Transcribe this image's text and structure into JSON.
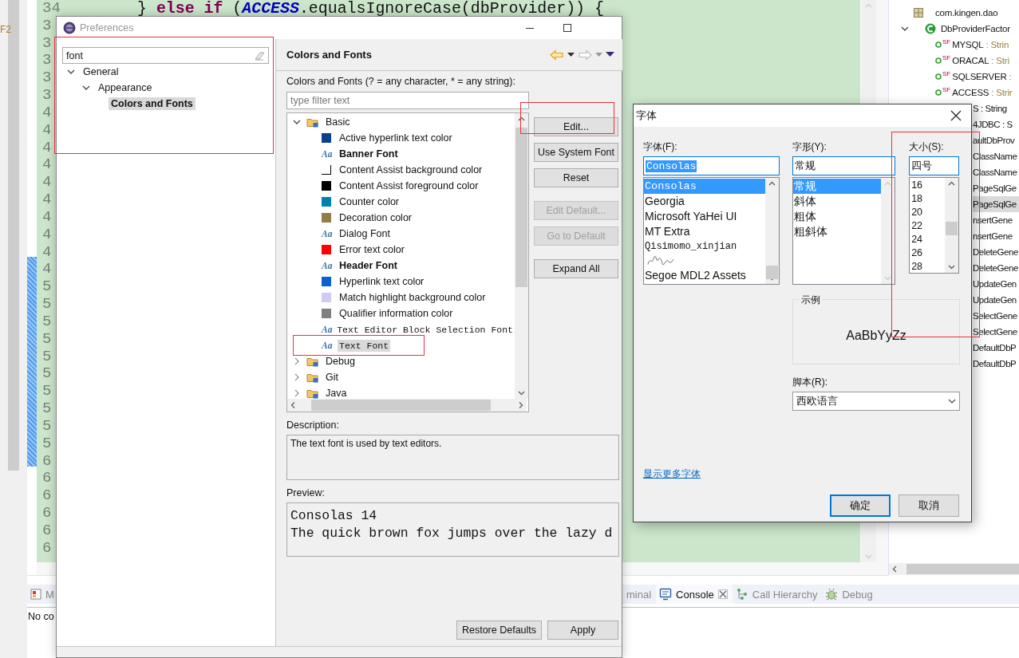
{
  "ide": {
    "gutter_label": "F2",
    "editor": {
      "code_line": "} **else if** (*ACCESS*.equalsIgnoreCase(dbProvider)) {",
      "line_numbers": [
        "34",
        "3",
        "3",
        "3",
        "3",
        "3",
        "4",
        "4",
        "4",
        "4",
        "4",
        "4",
        "4",
        "4",
        "4",
        "4",
        "5",
        "5",
        "5",
        "5",
        "5",
        "5",
        "5",
        "5",
        "5",
        "5",
        "6",
        "6",
        "6",
        "6",
        "6",
        "6"
      ]
    },
    "outline": {
      "items": [
        {
          "label": "com.kingen.dao",
          "kind": "package",
          "selected": false
        },
        {
          "label": "DbProviderFactor",
          "kind": "class",
          "expanded": true,
          "selected": false
        },
        {
          "label": "MYSQL",
          "type": ": Strin",
          "modifiers": "SF",
          "kind": "field",
          "selected": false
        },
        {
          "label": "ORACAL",
          "type": ": Stri",
          "modifiers": "SF",
          "kind": "field",
          "selected": false
        },
        {
          "label": "SQLSERVER",
          "type": ":",
          "modifiers": "SF",
          "kind": "field",
          "selected": false
        },
        {
          "label": "ACCESS",
          "type": ": Strir",
          "modifiers": "SF",
          "kind": "field",
          "selected": false
        },
        {
          "label": "S : String",
          "kind": "cut",
          "selected": false
        },
        {
          "label": "4JDBC : S",
          "kind": "cut",
          "selected": false
        },
        {
          "label": "aultDbProv",
          "kind": "cut",
          "selected": false
        },
        {
          "label": "ClassName",
          "kind": "cut",
          "selected": false
        },
        {
          "label": "ClassName",
          "kind": "cut",
          "selected": false
        },
        {
          "label": "PageSqlGe",
          "kind": "cut",
          "selected": false
        },
        {
          "label": "PageSqlGe",
          "kind": "cut",
          "selected": true
        },
        {
          "label": "nsertGene",
          "kind": "cut",
          "selected": false
        },
        {
          "label": "nsertGene",
          "kind": "cut",
          "selected": false
        },
        {
          "label": "DeleteGene",
          "kind": "cut",
          "selected": false
        },
        {
          "label": "DeleteGene",
          "kind": "cut",
          "selected": false
        },
        {
          "label": "UpdateGen",
          "kind": "cut",
          "selected": false
        },
        {
          "label": "UpdateGen",
          "kind": "cut",
          "selected": false
        },
        {
          "label": "SelectGene",
          "kind": "cut",
          "selected": false
        },
        {
          "label": "SelectGene",
          "kind": "cut",
          "selected": false
        },
        {
          "label": "DefaultDbP",
          "kind": "cut",
          "selected": false
        },
        {
          "label": "DefaultDbP",
          "kind": "cut",
          "selected": false
        }
      ]
    },
    "bottom_panel": {
      "left_tab": "M",
      "left_text": "No co",
      "tabs": [
        {
          "label": "minal",
          "kind": "cut",
          "selected": false
        },
        {
          "label": "Console",
          "kind": "console",
          "selected": true
        },
        {
          "label": "Call Hierarchy",
          "kind": "hierarchy",
          "selected": false
        },
        {
          "label": "Debug",
          "kind": "debug",
          "selected": false
        }
      ]
    }
  },
  "preferences": {
    "title": "Preferences",
    "filter_value": "font",
    "nav_tree": [
      {
        "label": "General",
        "expanded": true,
        "selected": false,
        "children": [
          {
            "label": "Appearance",
            "expanded": true,
            "selected": false,
            "children": [
              {
                "label": "Colors and Fonts",
                "selected": true
              }
            ]
          }
        ]
      }
    ],
    "page_title": "Colors and Fonts",
    "filter_label": "Colors and Fonts (? = any character, * = any string):",
    "filter_placeholder": "type filter text",
    "tree": [
      {
        "label": "Basic",
        "expanded": true,
        "children": [
          {
            "label": "Active hyperlink text color",
            "kind": "color",
            "color": "#0b3e8e",
            "selected": false
          },
          {
            "label": "Banner Font",
            "kind": "boldfont",
            "icon": "Aa",
            "selected": false
          },
          {
            "label": "Content Assist background color",
            "kind": "color",
            "color": "#ffffff",
            "selected": false
          },
          {
            "label": "Content Assist foreground color",
            "kind": "color",
            "color": "#000000",
            "selected": false
          },
          {
            "label": "Counter color",
            "kind": "color",
            "color": "#0080b0",
            "selected": false
          },
          {
            "label": "Decoration color",
            "kind": "color",
            "color": "#957d47",
            "selected": false
          },
          {
            "label": "Dialog Font",
            "kind": "font",
            "icon": "Aa",
            "selected": false
          },
          {
            "label": "Error text color",
            "kind": "color",
            "color": "#ff0000",
            "selected": false
          },
          {
            "label": "Header Font",
            "kind": "boldfont",
            "icon": "Aa",
            "selected": false
          },
          {
            "label": "Hyperlink text color",
            "kind": "color",
            "color": "#0a5fd3",
            "selected": false
          },
          {
            "label": "Match highlight background color",
            "kind": "color",
            "color": "#cfcbf5",
            "selected": false
          },
          {
            "label": "Qualifier information color",
            "kind": "color",
            "color": "#808080",
            "selected": false
          },
          {
            "label": "Text Editor Block Selection Font",
            "kind": "monofont",
            "icon": "Aa",
            "selected": false
          },
          {
            "label": "Text Font",
            "kind": "monofont",
            "icon": "Aa",
            "selected": true
          }
        ]
      },
      {
        "label": "Debug",
        "expanded": false
      },
      {
        "label": "Git",
        "expanded": false
      },
      {
        "label": "Java",
        "expanded": false
      }
    ],
    "buttons": [
      {
        "label": "Edit...",
        "disabled": false,
        "kind": "first"
      },
      {
        "label": "Use System Font",
        "disabled": false,
        "kind": "near"
      },
      {
        "label": "Reset",
        "disabled": false,
        "kind": "near"
      },
      {
        "label": "Edit Default...",
        "disabled": true,
        "kind": "far"
      },
      {
        "label": "Go to Default",
        "disabled": true,
        "kind": "near"
      },
      {
        "label": "Expand All",
        "disabled": false,
        "kind": "far"
      }
    ],
    "description_label": "Description:",
    "description": "The text font is used by text editors.",
    "preview_label": "Preview:",
    "preview_lines": [
      "Consolas 14",
      "The quick brown fox jumps over the lazy d"
    ],
    "footer_buttons": [
      "Restore Defaults",
      "Apply"
    ]
  },
  "font_dialog": {
    "title": "字体",
    "family": {
      "label": "字体(F):",
      "value": "Consolas",
      "options": [
        {
          "label": "Consolas",
          "kind": "mono",
          "selected": true
        },
        {
          "label": "Georgia",
          "kind": "text",
          "selected": false
        },
        {
          "label": "Microsoft YaHei UI",
          "kind": "text",
          "selected": false
        },
        {
          "label": "MT Extra",
          "kind": "text",
          "selected": false
        },
        {
          "label": "Qisimomo_xinjian",
          "kind": "mono",
          "selected": false
        },
        {
          "kind": "sample",
          "selected": false
        },
        {
          "label": "Segoe MDL2 Assets",
          "kind": "text",
          "selected": false
        }
      ]
    },
    "style": {
      "label": "字形(Y):",
      "value": "常规",
      "options": [
        {
          "label": "常规",
          "selected": true
        },
        {
          "label": "斜体",
          "selected": false
        },
        {
          "label": "粗体",
          "selected": false
        },
        {
          "label": "粗斜体",
          "selected": false
        }
      ]
    },
    "size": {
      "label": "大小(S):",
      "value": "四号",
      "options": [
        {
          "label": "16",
          "selected": false
        },
        {
          "label": "18",
          "selected": false
        },
        {
          "label": "20",
          "selected": false
        },
        {
          "label": "22",
          "selected": false
        },
        {
          "label": "24",
          "selected": false
        },
        {
          "label": "26",
          "selected": false
        },
        {
          "label": "28",
          "selected": false
        }
      ]
    },
    "sample": {
      "label": "示例",
      "text": "AaBbYyZz"
    },
    "script": {
      "label": "脚本(R):",
      "value": "西欧语言"
    },
    "link": "显示更多字体",
    "buttons": [
      {
        "label": "确定",
        "default": true
      },
      {
        "label": "取消",
        "default": false
      }
    ]
  },
  "annotation_frames": [
    {
      "kind": "frame"
    },
    {
      "kind": "frame"
    },
    {
      "kind": "frame"
    },
    {
      "kind": "frame"
    }
  ]
}
